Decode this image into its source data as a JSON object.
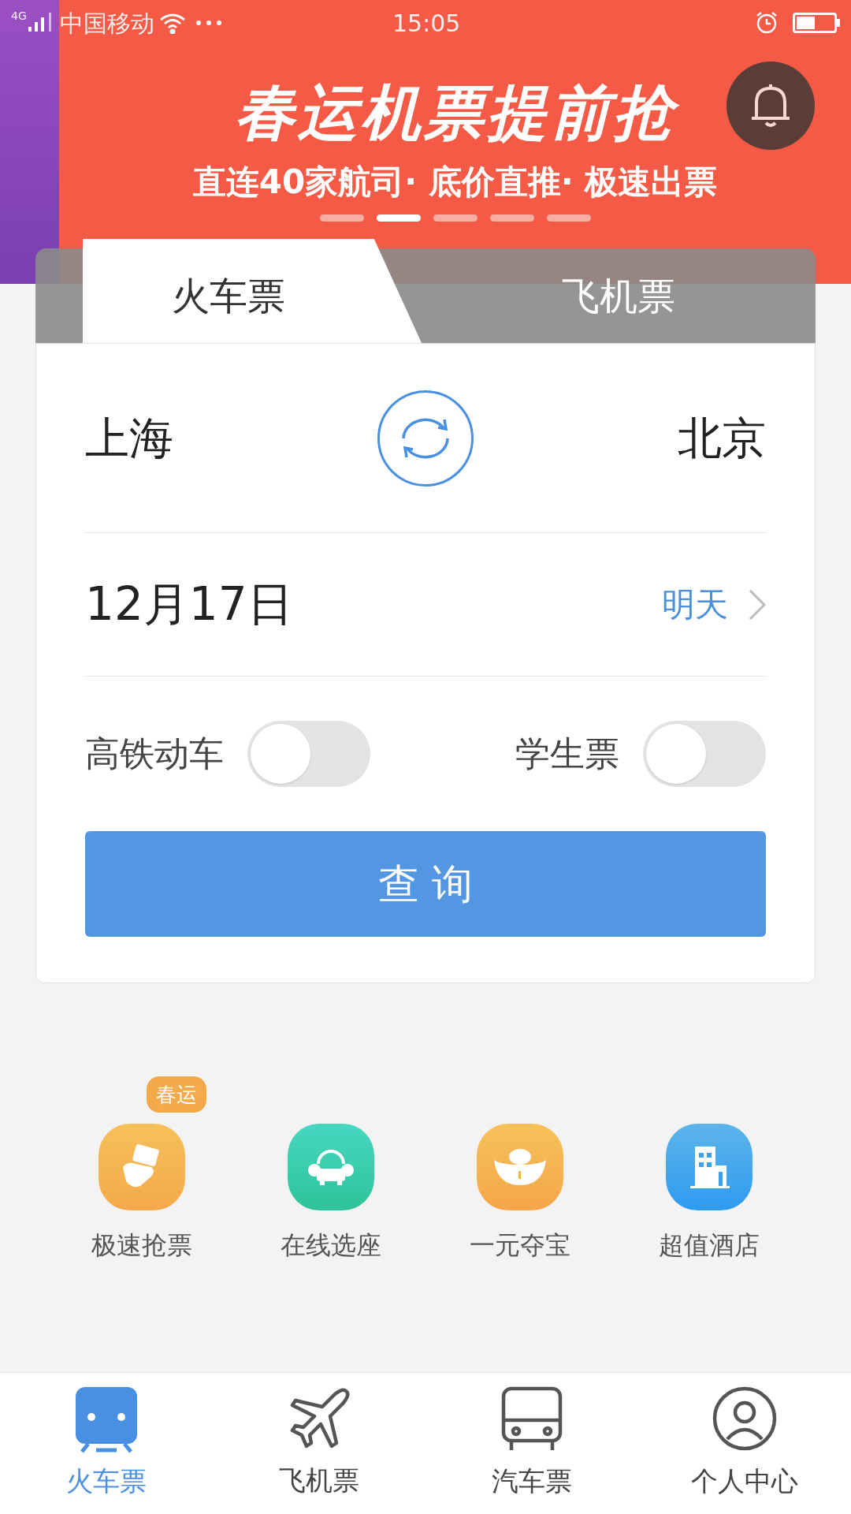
{
  "status_bar": {
    "network": "4G",
    "carrier": "中国移动",
    "time": "15:05"
  },
  "banner": {
    "headline": "春运机票提前抢",
    "subline": "直连40家航司· 底价直推· 极速出票",
    "pages": [
      {
        "selected": false
      },
      {
        "selected": true
      },
      {
        "selected": false
      },
      {
        "selected": false
      },
      {
        "selected": false
      }
    ]
  },
  "tabs": [
    {
      "label": "火车票",
      "selected": true
    },
    {
      "label": "飞机票",
      "selected": false
    }
  ],
  "route": {
    "from": "上海",
    "to": "北京"
  },
  "date": {
    "value": "12月17日",
    "relative": "明天"
  },
  "options": [
    {
      "label": "高铁动车",
      "on": false
    },
    {
      "label": "学生票",
      "on": false
    }
  ],
  "search_button": "查 询",
  "services": [
    {
      "label": "极速抢票",
      "badge": "春运",
      "kind": "ticket"
    },
    {
      "label": "在线选座",
      "kind": "seat"
    },
    {
      "label": "一元夺宝",
      "kind": "ingot"
    },
    {
      "label": "超值酒店",
      "kind": "hotel"
    }
  ],
  "bottom_nav": [
    {
      "label": "火车票",
      "kind": "train",
      "selected": true
    },
    {
      "label": "飞机票",
      "kind": "plane",
      "selected": false
    },
    {
      "label": "汽车票",
      "kind": "bus",
      "selected": false
    },
    {
      "label": "个人中心",
      "kind": "person",
      "selected": false
    }
  ]
}
